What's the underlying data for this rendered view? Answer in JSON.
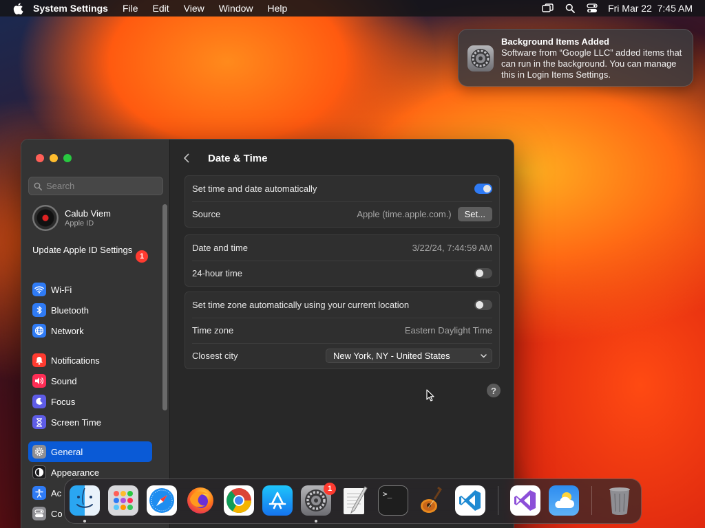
{
  "menubar": {
    "app_name": "System Settings",
    "menus": [
      "File",
      "Edit",
      "View",
      "Window",
      "Help"
    ],
    "clock": "Fri Mar 22  7:45 AM"
  },
  "notification": {
    "title": "Background Items Added",
    "body": "Software from “Google LLC” added items that can run in the background. You can manage this in Login Items Settings."
  },
  "sidebar": {
    "search_placeholder": "Search",
    "account": {
      "name": "Calub Viem",
      "subtitle": "Apple ID"
    },
    "update": {
      "label": "Update Apple ID Settings",
      "badge": "1"
    },
    "items": [
      {
        "label": "Wi-Fi",
        "icon": "wifi-icon",
        "color": "#2f7bf5"
      },
      {
        "label": "Bluetooth",
        "icon": "bluetooth-icon",
        "color": "#2f7bf5"
      },
      {
        "label": "Network",
        "icon": "globe-icon",
        "color": "#2f7bf5"
      },
      {
        "label": "Notifications",
        "icon": "bell-icon",
        "color": "#ff3b30"
      },
      {
        "label": "Sound",
        "icon": "speaker-icon",
        "color": "#ff2d55"
      },
      {
        "label": "Focus",
        "icon": "moon-icon",
        "color": "#5e5ce6"
      },
      {
        "label": "Screen Time",
        "icon": "hourglass-icon",
        "color": "#5e5ce6"
      },
      {
        "label": "General",
        "icon": "gear-icon",
        "color": "#8e8e93"
      },
      {
        "label": "Appearance",
        "icon": "appearance-icon",
        "color": "#1c1c1e"
      },
      {
        "label": "Ac",
        "icon": "accessibility-icon",
        "color": "#2f7bf5"
      },
      {
        "label": "Co",
        "icon": "control-center-icon",
        "color": "#8e8e93"
      }
    ],
    "selected": "General"
  },
  "main": {
    "title": "Date & Time",
    "auto_time": {
      "label": "Set time and date automatically",
      "on": true
    },
    "source": {
      "label": "Source",
      "value": "Apple (time.apple.com.)",
      "button": "Set..."
    },
    "date_time": {
      "label": "Date and time",
      "value": "3/22/24, 7:44:59 AM"
    },
    "hour24": {
      "label": "24-hour time",
      "on": false
    },
    "auto_tz": {
      "label": "Set time zone automatically using your current location",
      "on": false
    },
    "timezone": {
      "label": "Time zone",
      "value": "Eastern Daylight Time"
    },
    "closest_city": {
      "label": "Closest city",
      "value": "New York, NY - United States"
    },
    "help": "?"
  },
  "dock": {
    "items": [
      {
        "name": "finder-icon",
        "running": true
      },
      {
        "name": "launchpad-icon"
      },
      {
        "name": "safari-icon"
      },
      {
        "name": "firefox-icon"
      },
      {
        "name": "chrome-icon"
      },
      {
        "name": "app-store-icon"
      },
      {
        "name": "system-settings-icon",
        "running": true,
        "badge": "1"
      },
      {
        "name": "textedit-icon"
      },
      {
        "name": "terminal-icon",
        "label": ">_"
      },
      {
        "name": "garageband-icon"
      },
      {
        "name": "vscode-icon"
      },
      {
        "name": "visual-studio-icon"
      },
      {
        "name": "weather-icon"
      },
      {
        "name": "trash-icon"
      }
    ]
  },
  "colors": {
    "accent": "#0a5ad6",
    "toggle_on": "#2f7bf5",
    "badge": "#ff3b30"
  }
}
